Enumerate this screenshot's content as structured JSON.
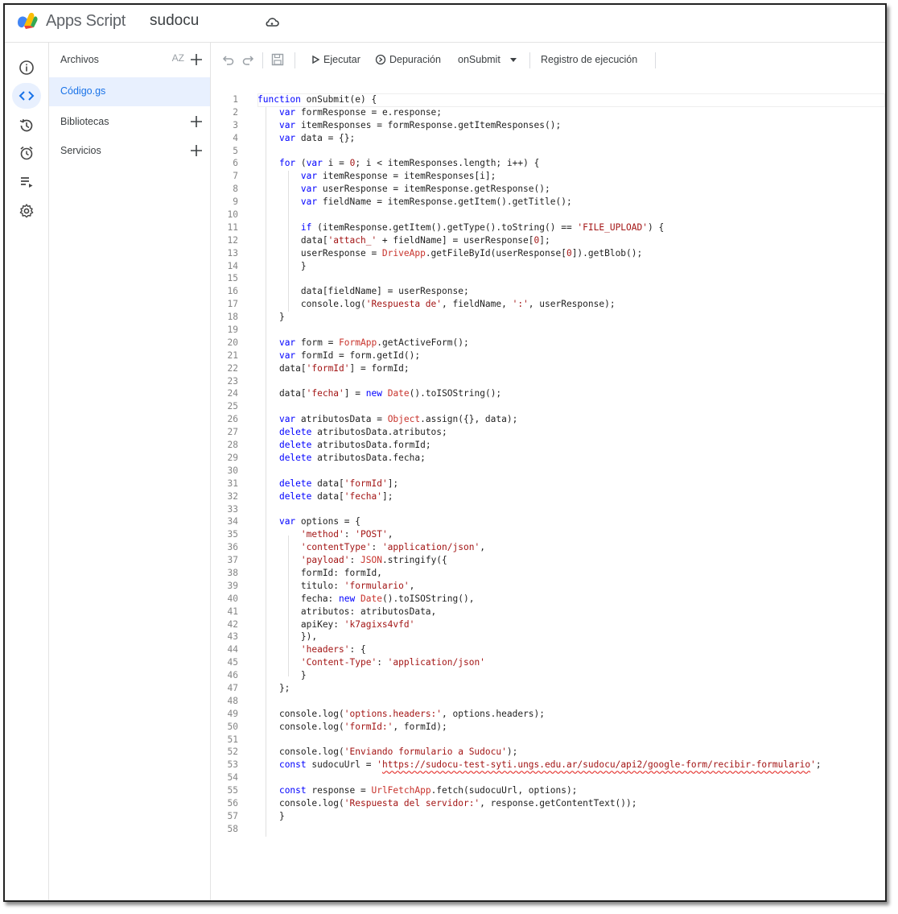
{
  "app": {
    "brand": "Apps Script",
    "project_name": "sudocu",
    "cloud_icon": "cloud-sync-icon"
  },
  "rail": {
    "items": [
      {
        "name": "overview",
        "icon": "info-icon"
      },
      {
        "name": "editor",
        "icon": "code-icon",
        "active": true
      },
      {
        "name": "versions",
        "icon": "history-icon"
      },
      {
        "name": "triggers",
        "icon": "alarm-icon"
      },
      {
        "name": "executions",
        "icon": "executions-icon"
      },
      {
        "name": "settings",
        "icon": "gear-icon"
      }
    ]
  },
  "files_panel": {
    "files_header": "Archivos",
    "sort_label": "AZ",
    "selected_file": "Código.gs",
    "libraries": "Bibliotecas",
    "services": "Servicios"
  },
  "toolbar": {
    "run": "Ejecutar",
    "debug": "Depuración",
    "function_selected": "onSubmit",
    "execution_log": "Registro de ejecución"
  },
  "code": {
    "language": "javascript",
    "lines": [
      "function onSubmit(e) {",
      "    var formResponse = e.response;",
      "    var itemResponses = formResponse.getItemResponses();",
      "    var data = {};",
      "",
      "    for (var i = 0; i < itemResponses.length; i++) {",
      "        var itemResponse = itemResponses[i];",
      "        var userResponse = itemResponse.getResponse();",
      "        var fieldName = itemResponse.getItem().getTitle();",
      "",
      "        if (itemResponse.getItem().getType().toString() == 'FILE_UPLOAD') {",
      "        data['attach_' + fieldName] = userResponse[0];",
      "        userResponse = DriveApp.getFileById(userResponse[0]).getBlob();",
      "        }",
      "",
      "        data[fieldName] = userResponse;",
      "        console.log('Respuesta de', fieldName, ':', userResponse);",
      "    }",
      "",
      "    var form = FormApp.getActiveForm();",
      "    var formId = form.getId();",
      "    data['formId'] = formId;",
      "",
      "    data['fecha'] = new Date().toISOString();",
      "",
      "    var atributosData = Object.assign({}, data);",
      "    delete atributosData.atributos;",
      "    delete atributosData.formId;",
      "    delete atributosData.fecha;",
      "",
      "    delete data['formId'];",
      "    delete data['fecha'];",
      "",
      "    var options = {",
      "        'method': 'POST',",
      "        'contentType': 'application/json',",
      "        'payload': JSON.stringify({",
      "        formId: formId,",
      "        titulo: 'formulario',",
      "        fecha: new Date().toISOString(),",
      "        atributos: atributosData,",
      "        apiKey: 'k7agixs4vfd'",
      "        }),",
      "        'headers': {",
      "        'Content-Type': 'application/json'",
      "        }",
      "    };",
      "",
      "    console.log('options.headers:', options.headers);",
      "    console.log('formId:', formId);",
      "",
      "    console.log('Enviando formulario a Sudocu');",
      "    const sudocuUrl = 'https://sudocu-test-syti.ungs.edu.ar/sudocu/api2/google-form/recibir-formulario';",
      "",
      "    const response = UrlFetchApp.fetch(sudocuUrl, options);",
      "    console.log('Respuesta del servidor:', response.getContentText());",
      "    }",
      ""
    ]
  },
  "colors": {
    "accent": "#1a73e8",
    "keyword": "#0000ff",
    "string": "#a31515",
    "builtin": "#c8322b"
  }
}
